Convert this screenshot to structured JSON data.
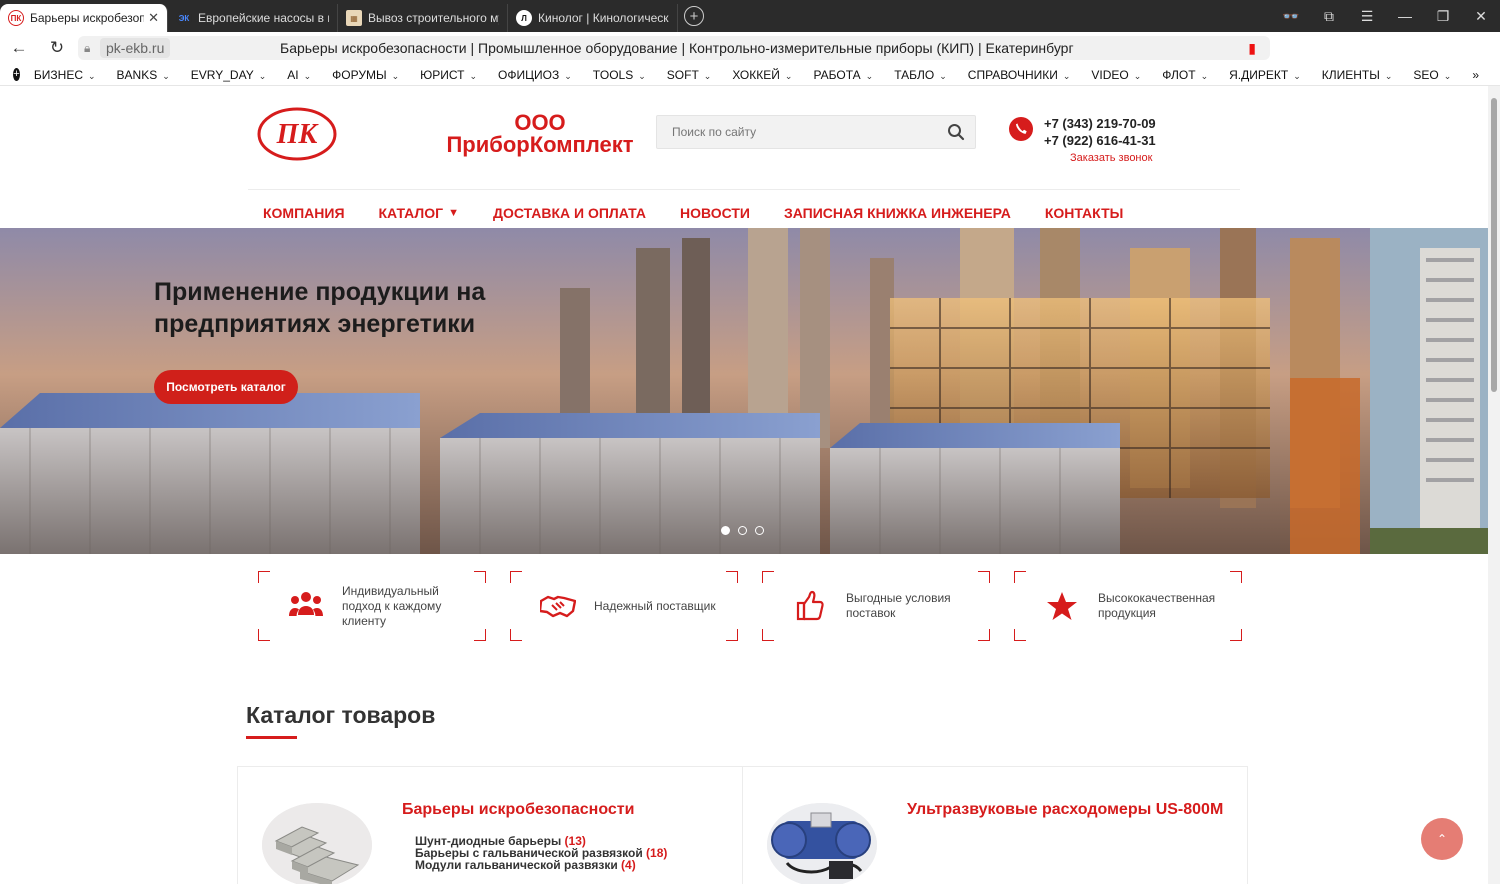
{
  "browser": {
    "tabs": [
      {
        "title": "Барьеры искробезопа",
        "fav_text": "ПК",
        "fav_bg": "#ffffff",
        "fav_fg": "#d61c1c",
        "active": true
      },
      {
        "title": "Европейские насосы в на",
        "fav_text": "ЭК",
        "fav_bg": "#2b2b2b",
        "fav_fg": "#4a88ff",
        "active": false
      },
      {
        "title": "Вывоз строительного му",
        "fav_text": "▦",
        "fav_bg": "#e9d7b8",
        "fav_fg": "#8a5a2a",
        "active": false
      },
      {
        "title": "Кинолог | Кинологически",
        "fav_text": "Л",
        "fav_bg": "#ffffff",
        "fav_fg": "#111111",
        "active": false
      }
    ],
    "close_glyph": "✕",
    "new_tab_glyph": "+",
    "url_host": "pk-ekb.ru",
    "page_title": "Барьеры искробезопасности | Промышленное оборудование | Контрольно-измерительные приборы (КИП) | Екатеринбург",
    "bookmarks": [
      "БИЗНЕС",
      "BANKS",
      "EVRY_DAY",
      "AI",
      "ФОРУМЫ",
      "ЮРИСТ",
      "ОФИЦИОЗ",
      "TOOLS",
      "SOFT",
      "ХОККЕЙ",
      "РАБОТА",
      "ТАБЛО",
      "СПРАВОЧНИКИ",
      "VIDEO",
      "ФЛОТ",
      "Я.ДИРЕКТ",
      "КЛИЕНТЫ",
      "SEO"
    ],
    "bookmarks_more": "»"
  },
  "header": {
    "logo_text": "ПК",
    "brand_line1": "ООО",
    "brand_line2": "ПриборКомплект",
    "search_placeholder": "Поиск по сайту",
    "phone1": "+7 (343) 219-70-09",
    "phone2": "+7 (922) 616-41-31",
    "callback": "Заказать звонок"
  },
  "nav": [
    {
      "label": "КОМПАНИЯ",
      "dropdown": false
    },
    {
      "label": "КАТАЛОГ",
      "dropdown": true
    },
    {
      "label": "ДОСТАВКА И ОПЛАТА",
      "dropdown": false
    },
    {
      "label": "НОВОСТИ",
      "dropdown": false
    },
    {
      "label": "ЗАПИСНАЯ КНИЖКА ИНЖЕНЕРА",
      "dropdown": false
    },
    {
      "label": "КОНТАКТЫ",
      "dropdown": false
    }
  ],
  "hero": {
    "title_line1": "Применение продукции на",
    "title_line2": "предприятиях энергетики",
    "button": "Посмотреть каталог",
    "slides_count": 3,
    "active_slide": 1
  },
  "features": [
    {
      "icon": "users-icon",
      "text": "Индивидуальный подход к каждому клиенту"
    },
    {
      "icon": "handshake-icon",
      "text": "Надежный поставщик"
    },
    {
      "icon": "thumbs-up-icon",
      "text": "Выгодные условия поставок"
    },
    {
      "icon": "star-icon",
      "text": "Высококачественная продукция"
    }
  ],
  "catalog": {
    "title": "Каталог товаров",
    "cards": [
      {
        "title": "Барьеры искробезопасности",
        "items": [
          {
            "name": "Шунт-диодные барьеры",
            "count": "(13)"
          },
          {
            "name": "Барьеры с гальванической развязкой",
            "count": "(18)"
          },
          {
            "name": "Модули гальванической развязки",
            "count": "(4)"
          }
        ]
      },
      {
        "title": "Ультразвуковые расходомеры US-800M",
        "items": []
      }
    ]
  },
  "colors": {
    "accent": "#d61c1c",
    "hero_button": "#d0201a",
    "to_top": "#e57d74"
  }
}
